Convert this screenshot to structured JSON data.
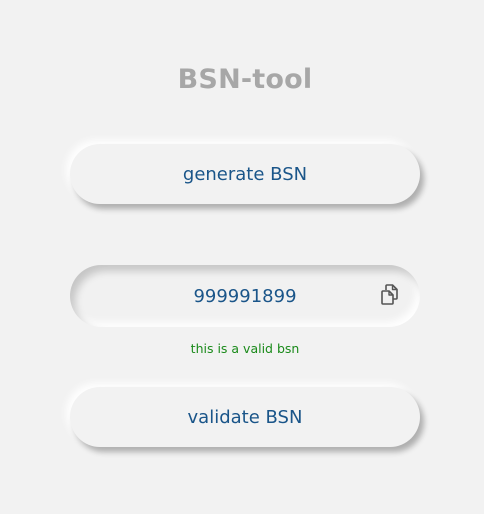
{
  "app": {
    "title": "BSN-tool"
  },
  "actions": {
    "generate_label": "generate BSN",
    "validate_label": "validate BSN"
  },
  "bsn_field": {
    "value": "999991899",
    "copy_icon": "copy-icon"
  },
  "validation": {
    "message": "this is a valid bsn",
    "status": "valid",
    "color": "#1a8a1a"
  },
  "colors": {
    "background": "#f2f2f2",
    "accent_text": "#1a5589",
    "title_text": "#a7a7a7"
  }
}
